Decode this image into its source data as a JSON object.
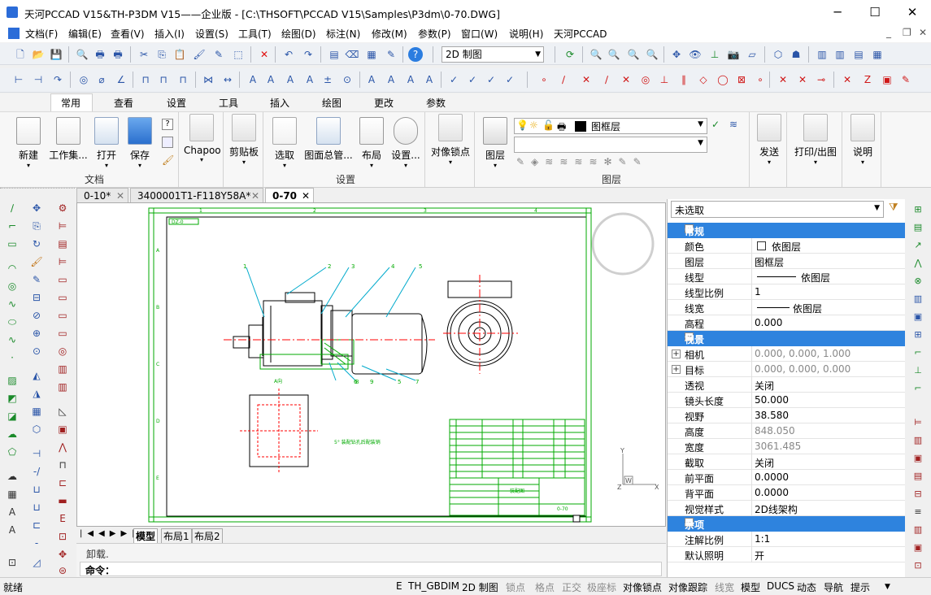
{
  "window": {
    "title": "天河PCCAD V15&TH-P3DM V15——企业版 - [C:\\THSOFT\\PCCAD V15\\Samples\\P3dm\\0-70.DWG]",
    "minimize": "─",
    "maximize": "☐",
    "close": "✕"
  },
  "menu": [
    "文档(F)",
    "编辑(E)",
    "查看(V)",
    "插入(I)",
    "设置(S)",
    "工具(T)",
    "绘图(D)",
    "标注(N)",
    "修改(M)",
    "参数(P)",
    "窗口(W)",
    "说明(H)",
    "天河PCCAD"
  ],
  "mdi": {
    "min": "_",
    "restore": "❐",
    "close": "✕"
  },
  "toolbar": {
    "view_combo": "2D 制图"
  },
  "ribbon": {
    "tabs": [
      "常用",
      "查看",
      "设置",
      "工具",
      "插入",
      "绘图",
      "更改",
      "参数"
    ],
    "active_tab": "常用",
    "buttons": {
      "new": "新建",
      "workset": "工作集...",
      "open": "打开",
      "save": "保存",
      "chapoo": "Chapoo",
      "clipboard": "剪贴板",
      "select": "选取",
      "overview": "图面总管...",
      "layout": "布局",
      "settings": "设置...",
      "snap": "对像锁点",
      "layer": "图层",
      "send": "发送",
      "print": "打印/出图",
      "help": "说明"
    },
    "groups": {
      "doc": "文档",
      "settings": "设置",
      "layer": "图层"
    },
    "layer_combo": "图框层"
  },
  "doc_tabs": [
    "0-10*",
    "3400001T1-F118Y58A*",
    "0-70"
  ],
  "active_doc": "0-70",
  "layout_tabs": [
    "模型",
    "布局1",
    "布局2"
  ],
  "command": {
    "history": "卸载.",
    "prompt": "命令："
  },
  "drawing": {
    "frame_label": "DZ-0",
    "col_marks": [
      "1",
      "2",
      "3",
      "4"
    ],
    "row_marks": [
      "A",
      "B",
      "C",
      "D",
      "E"
    ],
    "balloons": [
      "1",
      "2",
      "3",
      "4",
      "5",
      "6",
      "7",
      "8",
      "9",
      "5"
    ],
    "view_label": "A向",
    "note": "5° 装配钻孔后配装销",
    "ucs": {
      "x": "X",
      "y": "Y",
      "z": "Z",
      "w": "W"
    },
    "title_block": {
      "name": "装配图",
      "code": "0-70"
    }
  },
  "properties": {
    "selection": "未选取",
    "categories": [
      {
        "name": "常规",
        "rows": [
          [
            "颜色",
            "依图层"
          ],
          [
            "图层",
            "图框层"
          ],
          [
            "线型",
            "依图层"
          ],
          [
            "线型比例",
            "1"
          ],
          [
            "线宽",
            "依图层"
          ],
          [
            "高程",
            "0.000"
          ]
        ]
      },
      {
        "name": "视景",
        "rows": [
          [
            "相机",
            "0.000, 0.000, 1.000"
          ],
          [
            "目标",
            "0.000, 0.000, 0.000"
          ],
          [
            "透视",
            "关闭"
          ],
          [
            "镜头长度",
            "50.000"
          ],
          [
            "视野",
            "38.580"
          ],
          [
            "高度",
            "848.050"
          ],
          [
            "宽度",
            "3061.485"
          ],
          [
            "截取",
            "关闭"
          ],
          [
            "前平面",
            "0.0000"
          ],
          [
            "背平面",
            "0.0000"
          ],
          [
            "视觉样式",
            "2D线架构"
          ]
        ]
      },
      {
        "name": "杂项",
        "rows": [
          [
            "注解比例",
            "1:1"
          ],
          [
            "默认照明",
            "开"
          ]
        ]
      }
    ]
  },
  "status": {
    "ready": "就绪",
    "items": [
      "E",
      "TH_GBDIM",
      "2D 制图",
      "锁点",
      "格点",
      "正交",
      "极座标",
      "对像锁点",
      "对像跟踪",
      "线宽",
      "模型",
      "DUCS",
      "动态",
      "导航",
      "提示"
    ]
  },
  "colors": {
    "accent": "#2e83de",
    "cad_green": "#00aa00",
    "cad_cyan": "#00aacc",
    "cad_red": "#ff0000"
  }
}
